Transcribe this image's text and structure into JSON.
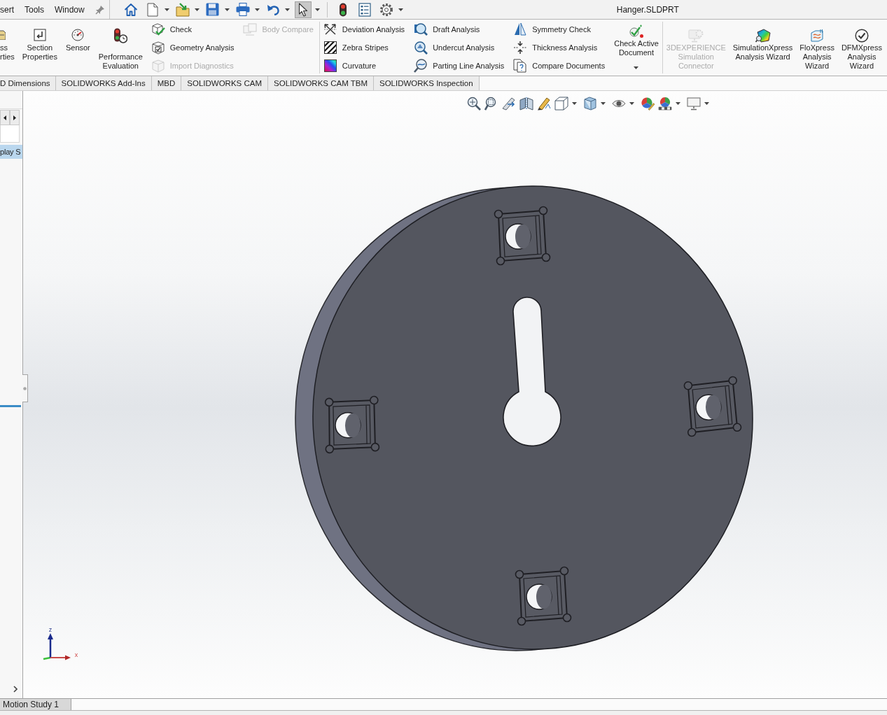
{
  "menu": [
    "sert",
    "Tools",
    "Window"
  ],
  "quick_access": [
    {
      "pressed": false,
      "dropdown": false
    },
    {
      "pressed": false,
      "dropdown": true
    },
    {
      "pressed": false,
      "dropdown": true
    },
    {
      "pressed": false,
      "dropdown": true
    },
    {
      "pressed": false,
      "dropdown": true
    },
    {
      "pressed": false,
      "dropdown": true
    },
    {
      "pressed": true,
      "dropdown": true
    },
    {
      "pressed": false,
      "dropdown": false
    },
    {
      "pressed": false,
      "dropdown": false
    },
    {
      "pressed": false,
      "dropdown": true
    }
  ],
  "window": {
    "title": "Hanger.SLDPRT"
  },
  "ribbon": [
    {
      "groups": [
        {
          "kind": "large",
          "label": "ss\nrties",
          "disabled": false,
          "dropdown": false
        },
        {
          "kind": "large",
          "label": "Section\nProperties",
          "disabled": false,
          "dropdown": false
        },
        {
          "kind": "large",
          "label": "Sensor",
          "disabled": false,
          "dropdown": false
        },
        {
          "kind": "large",
          "label": "Performance\nEvaluation",
          "disabled": false,
          "dropdown": false
        },
        {
          "kind": "column",
          "items": [
            {
              "label": "Check",
              "disabled": false
            },
            {
              "label": "Geometry Analysis",
              "disabled": false
            },
            {
              "label": "Import Diagnostics",
              "disabled": true
            }
          ]
        },
        {
          "kind": "column",
          "items": [
            {
              "label": "Body Compare",
              "disabled": true
            }
          ]
        }
      ]
    },
    {
      "groups": [
        {
          "kind": "column",
          "items": [
            {
              "label": "Deviation Analysis",
              "disabled": false
            },
            {
              "label": "Zebra Stripes",
              "disabled": false
            },
            {
              "label": "Curvature",
              "disabled": false
            }
          ]
        },
        {
          "kind": "column",
          "items": [
            {
              "label": "Draft Analysis",
              "disabled": false
            },
            {
              "label": "Undercut Analysis",
              "disabled": false
            },
            {
              "label": "Parting Line Analysis",
              "disabled": false
            }
          ]
        },
        {
          "kind": "column",
          "items": [
            {
              "label": "Symmetry Check",
              "disabled": false
            },
            {
              "label": "Thickness Analysis",
              "disabled": false
            },
            {
              "label": "Compare Documents",
              "disabled": false
            }
          ]
        },
        {
          "kind": "large",
          "label": "Check Active\nDocument",
          "disabled": false,
          "dropdown": true
        }
      ]
    },
    {
      "groups": [
        {
          "kind": "large",
          "label": "3DEXPERIENCE\nSimulation\nConnector",
          "disabled": true,
          "dropdown": false
        },
        {
          "kind": "large",
          "label": "SimulationXpress\nAnalysis Wizard",
          "disabled": false,
          "dropdown": false
        },
        {
          "kind": "large",
          "label": "FloXpress\nAnalysis\nWizard",
          "disabled": false,
          "dropdown": false
        },
        {
          "kind": "large",
          "label": "DFMXpress\nAnalysis\nWizard",
          "disabled": false,
          "dropdown": false
        }
      ]
    }
  ],
  "tabs": [
    {
      "label": "D Dimensions",
      "selected": false
    },
    {
      "label": "SOLIDWORKS Add-Ins",
      "selected": false
    },
    {
      "label": "MBD",
      "selected": false
    },
    {
      "label": "SOLIDWORKS CAM",
      "selected": false
    },
    {
      "label": "SOLIDWORKS CAM TBM",
      "selected": false
    },
    {
      "label": "SOLIDWORKS Inspection",
      "selected": false
    }
  ],
  "left_panel": {
    "items": [
      {
        "label": "play S",
        "selected": true
      }
    ]
  },
  "view_toolbar": [
    {
      "dropdown": false
    },
    {
      "dropdown": false
    },
    {
      "dropdown": false
    },
    {
      "dropdown": false
    },
    {
      "dropdown": false
    },
    {
      "dropdown": true
    },
    {
      "dropdown": true
    },
    {
      "dropdown": true
    },
    {
      "dropdown": false
    },
    {
      "dropdown": true
    },
    {
      "dropdown": true
    }
  ],
  "triad": {
    "z_label": "z",
    "x_label": "x"
  },
  "motion_tabs": [
    {
      "label": "Motion Study 1",
      "selected": true
    }
  ]
}
